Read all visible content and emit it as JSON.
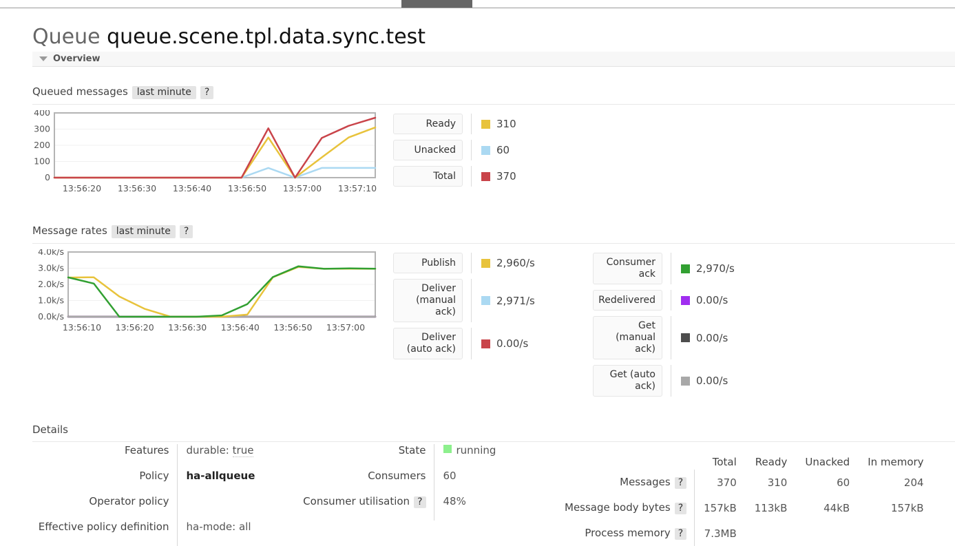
{
  "topbar": {
    "active_tab_name": "queues-tab"
  },
  "header": {
    "entity_type": "Queue",
    "queue_name": "queue.scene.tpl.data.sync.test"
  },
  "overview": {
    "label": "Overview"
  },
  "queued_messages": {
    "label": "Queued messages",
    "range": "last minute",
    "help": "?",
    "legend": [
      {
        "label": "Ready",
        "value": "310",
        "color": "#e8c33c"
      },
      {
        "label": "Unacked",
        "value": "60",
        "color": "#abd9f2"
      },
      {
        "label": "Total",
        "value": "370",
        "color": "#c9444a"
      }
    ]
  },
  "message_rates": {
    "label": "Message rates",
    "range": "last minute",
    "help": "?",
    "legend_left": [
      {
        "label": "Publish",
        "value": "2,960/s",
        "color": "#e8c33c"
      },
      {
        "label": "Deliver (manual ack)",
        "value": "2,971/s",
        "color": "#abd9f2"
      },
      {
        "label": "Deliver (auto ack)",
        "value": "0.00/s",
        "color": "#c9444a"
      }
    ],
    "legend_right": [
      {
        "label": "Consumer ack",
        "value": "2,970/s",
        "color": "#32a032"
      },
      {
        "label": "Redelivered",
        "value": "0.00/s",
        "color": "#a02ef0"
      },
      {
        "label": "Get (manual ack)",
        "value": "0.00/s",
        "color": "#4d4d4d"
      },
      {
        "label": "Get (auto ack)",
        "value": "0.00/s",
        "color": "#a8a8a8"
      }
    ]
  },
  "details": {
    "label": "Details",
    "left": [
      {
        "key": "Features",
        "value": "durable: true",
        "style": "feature"
      },
      {
        "key": "Policy",
        "value": "ha-allqueue",
        "style": "bold"
      },
      {
        "key": "Operator policy",
        "value": "",
        "style": "plain"
      },
      {
        "key": "Effective policy definition",
        "value": "ha-mode: all",
        "style": "plain"
      }
    ],
    "middle": [
      {
        "key": "State",
        "value": "running",
        "style": "state",
        "color": "#8df08d"
      },
      {
        "key": "Consumers",
        "value": "60",
        "style": "plain"
      },
      {
        "key": "Consumer utilisation",
        "value": "48%",
        "style": "plain",
        "help": "?"
      }
    ],
    "stats": {
      "columns": [
        "Total",
        "Ready",
        "Unacked",
        "In memory"
      ],
      "rows": [
        {
          "label": "Messages",
          "help": "?",
          "values": [
            "370",
            "310",
            "60",
            "204"
          ]
        },
        {
          "label": "Message body bytes",
          "help": "?",
          "values": [
            "157kB",
            "113kB",
            "44kB",
            "157kB"
          ]
        },
        {
          "label": "Process memory",
          "help": "?",
          "values": [
            "7.3MB",
            "",
            "",
            ""
          ]
        }
      ]
    }
  },
  "chart_data": [
    {
      "type": "line",
      "title": "Queued messages",
      "xlabel": "",
      "ylabel": "",
      "ylim": [
        0,
        400
      ],
      "yticks": [
        0,
        100,
        200,
        300,
        400
      ],
      "xticks": [
        "13:56:20",
        "13:56:30",
        "13:56:40",
        "13:56:50",
        "13:57:00",
        "13:57:10"
      ],
      "grid": true,
      "legend_position": "right",
      "x": [
        "13:56:15",
        "13:56:20",
        "13:56:25",
        "13:56:30",
        "13:56:35",
        "13:56:40",
        "13:56:45",
        "13:56:50",
        "13:56:55",
        "13:57:00",
        "13:57:05",
        "13:57:10",
        "13:57:13"
      ],
      "series": [
        {
          "name": "Ready",
          "color": "#e8c33c",
          "values": [
            0,
            0,
            0,
            0,
            0,
            0,
            0,
            0,
            248,
            0,
            125,
            248,
            310
          ]
        },
        {
          "name": "Unacked",
          "color": "#abd9f2",
          "values": [
            0,
            0,
            0,
            0,
            0,
            0,
            0,
            0,
            60,
            0,
            60,
            60,
            60
          ]
        },
        {
          "name": "Total",
          "color": "#c9444a",
          "values": [
            0,
            0,
            0,
            0,
            0,
            0,
            0,
            0,
            305,
            0,
            245,
            320,
            370
          ]
        }
      ]
    },
    {
      "type": "line",
      "title": "Message rates",
      "xlabel": "",
      "ylabel": "",
      "ylim": [
        0,
        4000
      ],
      "yticks": [
        "0.0k/s",
        "1.0k/s",
        "2.0k/s",
        "3.0k/s",
        "4.0k/s"
      ],
      "xticks": [
        "13:56:10",
        "13:56:20",
        "13:56:30",
        "13:56:40",
        "13:56:50",
        "13:57:00"
      ],
      "grid": true,
      "legend_position": "right",
      "x": [
        "13:56:07",
        "13:56:12",
        "13:56:17",
        "13:56:22",
        "13:56:27",
        "13:56:32",
        "13:56:37",
        "13:56:42",
        "13:56:47",
        "13:56:52",
        "13:56:57",
        "13:57:02",
        "13:57:05"
      ],
      "series": [
        {
          "name": "Publish",
          "color": "#e8c33c",
          "values": [
            2420,
            2440,
            1250,
            480,
            0,
            0,
            0,
            130,
            2440,
            3080,
            2960,
            2970,
            2960
          ]
        },
        {
          "name": "Consumer ack",
          "color": "#32a032",
          "values": [
            2430,
            2050,
            0,
            0,
            0,
            0,
            80,
            780,
            2450,
            3120,
            2960,
            2990,
            2970
          ]
        },
        {
          "name": "Deliver (manual ack)",
          "color": "#abd9f2",
          "values": [
            0,
            0,
            0,
            0,
            0,
            0,
            0,
            0,
            0,
            0,
            0,
            0,
            0
          ]
        },
        {
          "name": "Deliver (auto ack)",
          "color": "#c9444a",
          "values": [
            0,
            0,
            0,
            0,
            0,
            0,
            0,
            0,
            0,
            0,
            0,
            0,
            0
          ]
        },
        {
          "name": "Redelivered",
          "color": "#a02ef0",
          "values": [
            0,
            0,
            0,
            0,
            0,
            0,
            0,
            0,
            0,
            0,
            0,
            0,
            0
          ]
        },
        {
          "name": "Get (manual ack)",
          "color": "#4d4d4d",
          "values": [
            0,
            0,
            0,
            0,
            0,
            0,
            0,
            0,
            0,
            0,
            0,
            0,
            0
          ]
        },
        {
          "name": "Get (auto ack)",
          "color": "#a8a8a8",
          "values": [
            0,
            0,
            0,
            0,
            0,
            0,
            0,
            0,
            0,
            0,
            0,
            0,
            0
          ]
        }
      ]
    }
  ]
}
